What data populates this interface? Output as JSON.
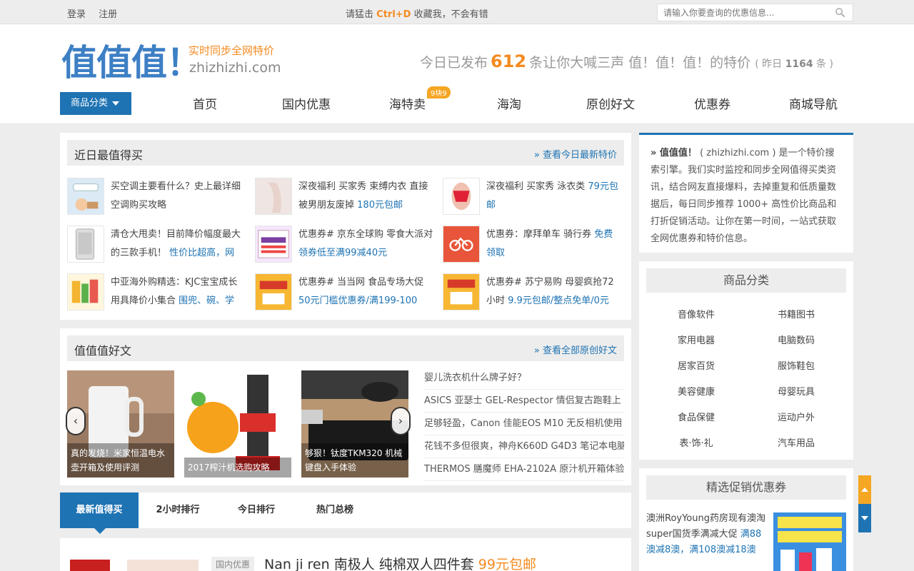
{
  "topbar": {
    "login": "登录",
    "register": "注册",
    "tip_prefix": "请猛击",
    "tip_key": "Ctrl+D",
    "tip_suffix": "收藏我，不会有错",
    "search_placeholder": "请输入你要查询的优惠信息..."
  },
  "header": {
    "logo": "值值值！",
    "slogan": "实时同步全网特价",
    "domain": "zhizhizhi.com",
    "today_prefix": "今日已发布",
    "today_count": "612",
    "today_suffix": "条让你大喊三声 值！值！值！的特价",
    "yesterday_prefix": "( 昨日",
    "yesterday_count": "1164",
    "yesterday_suffix": "条 )"
  },
  "nav": {
    "category_button": "商品分类",
    "items": [
      "首页",
      "国内优惠",
      "海特卖",
      "海淘",
      "原创好文",
      "优惠券",
      "商城导航"
    ],
    "badge": "9块9"
  },
  "recent": {
    "title": "近日最值得买",
    "more": "» 查看今日最新特价",
    "deals": [
      {
        "text": "买空调主要看什么？史上最详细空调购买攻略",
        "price": ""
      },
      {
        "text": "深夜福利 买家秀 束缚内衣 直接被男朋友废掉",
        "price": "180元包邮"
      },
      {
        "text": "深夜福利 买家秀 泳衣类",
        "price": "79元包邮"
      },
      {
        "text": "清仓大甩卖！目前降价幅度最大的三款手机！",
        "price": "性价比超高，网"
      },
      {
        "text": "优惠券# 京东全球购 零食大派对",
        "price": "领券低至满99减40元"
      },
      {
        "text": "优惠券：摩拜单车 骑行券",
        "price": "免费领取"
      },
      {
        "text": "中亚海外购精选：KJC宝宝成长用具降价小集合",
        "price": "围兜、碗、学"
      },
      {
        "text": "优惠券# 当当网 食品专场大促",
        "price": "50元门槛优惠券/满199-100"
      },
      {
        "text": "优惠券# 苏宁易购 母婴疯抢72小时",
        "price": "9.9元包邮/整点免单/0元"
      }
    ]
  },
  "articles": {
    "title": "值值值好文",
    "more": "» 查看全部原创好文",
    "cards": [
      {
        "caption": "真的发烧！米家恒温电水壶开箱及使用评测"
      },
      {
        "caption": "2017榨汁机选购攻略"
      },
      {
        "caption": "够狠！钛度TKM320 机械键盘入手体验"
      }
    ],
    "list": [
      "婴儿洗衣机什么牌子好？",
      "ASICS 亚瑟士 GEL-Respector 情侣复古跑鞋上",
      "足够轻盈，Canon 佳能EOS M10 无反相机使用",
      "花钱不多但很爽，神舟K660D G4D3 笔记本电脑",
      "THERMOS 膳魔师 EHA-2102A 原汁机开箱体验"
    ]
  },
  "tabs": [
    "最新值得买",
    "2小时排行",
    "今日排行",
    "热门总榜"
  ],
  "feed": {
    "tag": "国内优惠",
    "title": "Nan ji ren 南极人 纯棉双人四件套",
    "price": "99元包邮"
  },
  "about": {
    "brand": "» 值值值！",
    "text": "( zhizhizhi.com ) 是一个特价搜索引擎。我们实时监控和同步全网值得买类资讯，结合网友直接爆料，去掉重复和低质量数据后，每日同步推荐 1000+ 高性价比商品和打折促销活动。让你在第一时间，一站式获取全网优惠券和特价信息。"
  },
  "categories": {
    "title": "商品分类",
    "items": [
      "音像软件",
      "书籍图书",
      "家用电器",
      "电脑数码",
      "居家百货",
      "服饰鞋包",
      "美容健康",
      "母婴玩具",
      "食品保健",
      "运动户外",
      "表·饰·礼",
      "汽车用品"
    ]
  },
  "coupons": {
    "title": "精选促销优惠券",
    "text": "澳洲RoyYoung药房现有澳淘super国货季满减大促",
    "price": "满88澳减8澳，满108澳减18澳"
  },
  "colors": {
    "accent": "#1e73b3",
    "orange": "#f58a1f",
    "bg": "#ededed"
  }
}
